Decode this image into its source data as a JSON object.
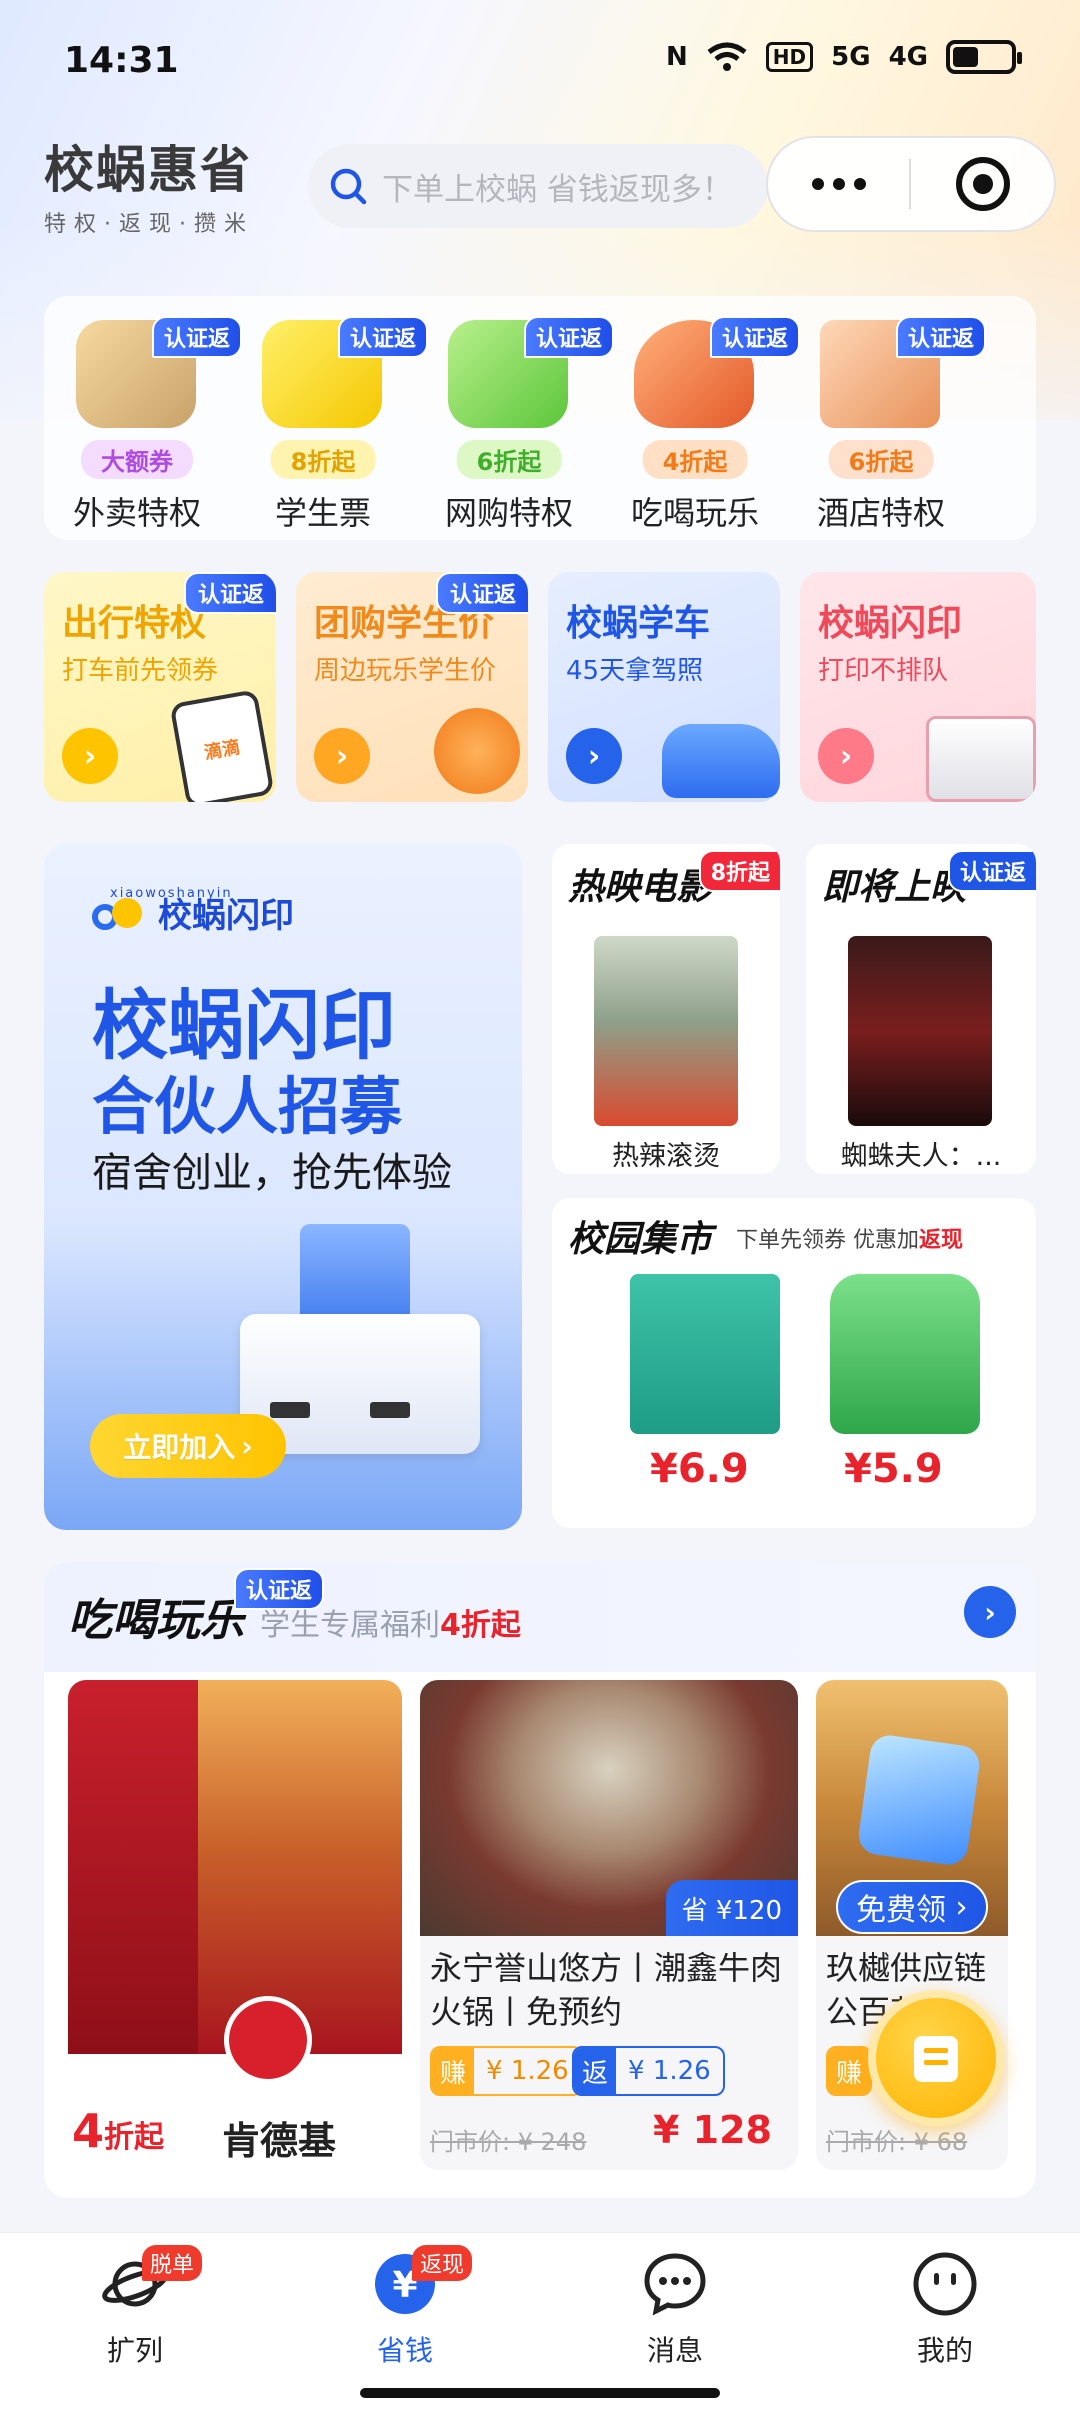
{
  "status_bar": {
    "time": "14:31",
    "nfc": "N",
    "wifi": "wifi",
    "hd": "HD",
    "net1": "5G",
    "net2": "4G",
    "battery_level": 0.45
  },
  "header": {
    "brand_name": "校蜗惠省",
    "brand_slogan": "特权·返现·攒米",
    "search_placeholder": "下单上校蜗 省钱返现多！"
  },
  "categories": [
    {
      "label": "外卖特权",
      "tag": "大额券",
      "badge": "认证返"
    },
    {
      "label": "学生票",
      "tag": "8折起",
      "badge": "认证返"
    },
    {
      "label": "网购特权",
      "tag": "6折起",
      "badge": "认证返"
    },
    {
      "label": "吃喝玩乐",
      "tag": "4折起",
      "badge": "认证返"
    },
    {
      "label": "酒店特权",
      "tag": "6折起",
      "badge": "认证返"
    }
  ],
  "promos": [
    {
      "title": "出行特权",
      "sub": "打车前先领券",
      "badge": "认证返",
      "art_label": "滴滴"
    },
    {
      "title": "团购学生价",
      "sub": "周边玩乐学生价",
      "badge": "认证返"
    },
    {
      "title": "校蜗学车",
      "sub": "45天拿驾照"
    },
    {
      "title": "校蜗闪印",
      "sub": "打印不排队"
    }
  ],
  "banner": {
    "logo_text": "校蜗闪印",
    "logo_sub": "xiaowoshanyin",
    "headline1": "校蜗闪印",
    "headline2": "合伙人招募",
    "subline": "宿舍创业，抢先体验",
    "cta": "立即加入"
  },
  "movies": [
    {
      "section": "热映电影",
      "badge": "8折起",
      "name": "热辣滚烫"
    },
    {
      "section": "即将上映",
      "badge": "认证返",
      "name": "蜘蛛夫人：..."
    }
  ],
  "market": {
    "title": "校园集市",
    "sub": "下单先领券 优惠加",
    "sub_highlight": "返现",
    "products": [
      {
        "price": "¥6.9"
      },
      {
        "price": "¥5.9"
      }
    ]
  },
  "food": {
    "title": "吃喝玩乐",
    "badge": "认证返",
    "sub": "学生专属福利",
    "sub_highlight": "4折起",
    "deals": [
      {
        "discount_num": "4",
        "discount_unit": "折起",
        "brand": "肯德基"
      },
      {
        "name": "永宁誉山悠方丨潮鑫牛肉火锅丨免预约",
        "corner": "省 ¥120",
        "earn_k": "赚",
        "earn_v": "¥ 1.26",
        "ret_k": "返",
        "ret_v": "¥ 1.26",
        "orig": "门市价: ¥ 248",
        "price": "¥ 128"
      },
      {
        "name": "玖樾供应链公百花",
        "corner": "免费领",
        "earn_k": "赚",
        "orig": "门市价: ¥ 68"
      }
    ]
  },
  "nav": [
    {
      "label": "扩列",
      "badge": "脱单"
    },
    {
      "label": "省钱",
      "badge": "返现"
    },
    {
      "label": "消息"
    },
    {
      "label": "我的"
    }
  ],
  "colors": {
    "brand_blue": "#1f56e6",
    "red": "#e8232c",
    "yellow": "#ffc400"
  }
}
